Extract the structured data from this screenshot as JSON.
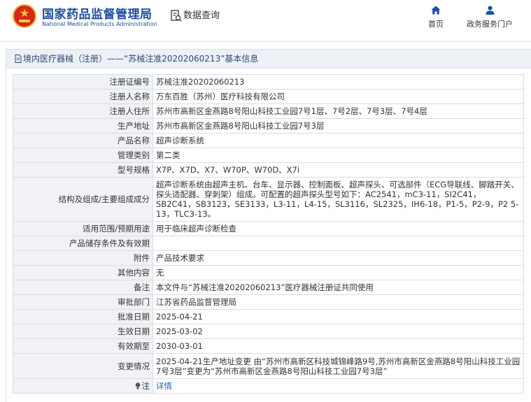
{
  "header": {
    "site_name_cn": "国家药品监督管理局",
    "site_name_en": "National Medical Products Administration",
    "search_label": "数据查询",
    "nav": [
      {
        "label": "首页",
        "icon": "home-icon"
      },
      {
        "label": "政务服务门户",
        "icon": "user-icon"
      }
    ]
  },
  "panel": {
    "title": "境内医疗器械（注册）——“苏械注准20202060213”基本信息"
  },
  "rows": [
    {
      "label": "注册证编号",
      "value": "苏械注准20202060213"
    },
    {
      "label": "注册人名称",
      "value": "万东百胜（苏州）医疗科技有限公司"
    },
    {
      "label": "注册人住所",
      "value": "苏州市高新区金燕路8号阳山科技工业园7号1层、7号2层、7号3层、7号4层"
    },
    {
      "label": "生产地址",
      "value": "苏州市高新区金燕路8号阳山科技工业园7号3层"
    },
    {
      "label": "产品名称",
      "value": "超声诊断系统"
    },
    {
      "label": "管理类别",
      "value": "第二类"
    },
    {
      "label": "型号规格",
      "value": "X7P、X7D、X7、W70P、W70D、X7i"
    },
    {
      "label": "结构及组成/主要组成成分",
      "value": "超声诊断系统由超声主机、台车、显示器、控制面板、超声探头、可选部件（ECG导联线、脚踏开关、探头适配器、穿刺架）组成。可配置的超声探头型号如下：AC2541，mC3-11，SI2C41，SB2C41，SB3123，SE3133，L3-11，L4-15，SL3116，SL2325，IH6-18，P1-5，P2-9，P2 5-13，TLC3-13。"
    },
    {
      "label": "适用范围/预期用途",
      "value": "用于临床超声诊断检查"
    },
    {
      "label": "产品储存条件及有效期",
      "value": ""
    },
    {
      "label": "附件",
      "value": "产品技术要求"
    },
    {
      "label": "其他内容",
      "value": "无"
    },
    {
      "label": "备注",
      "value": "本文件与“苏械注准20202060213”医疗器械注册证共同使用"
    },
    {
      "label": "审批部门",
      "value": "江苏省药品监督管理局"
    },
    {
      "label": "批准日期",
      "value": "2025-04-21"
    },
    {
      "label": "生效日期",
      "value": "2025-03-02"
    },
    {
      "label": "有效期至",
      "value": "2030-03-01"
    },
    {
      "label": "变更情况",
      "value": "2025-04-21生产地址变更 由“苏州市高新区科技城锦峰路9号,苏州市高新区金燕路8号阳山科技工业园7号3层”变更为“苏州市高新区金燕路8号阳山科技工业园7号3层”"
    }
  ],
  "note_row": {
    "label": "注",
    "link_label": "详情",
    "icon": "bulb-icon"
  },
  "colors": {
    "brand_blue": "#1c4fa0",
    "link": "#1c62c8",
    "label_bg": "#f0f2f5"
  }
}
